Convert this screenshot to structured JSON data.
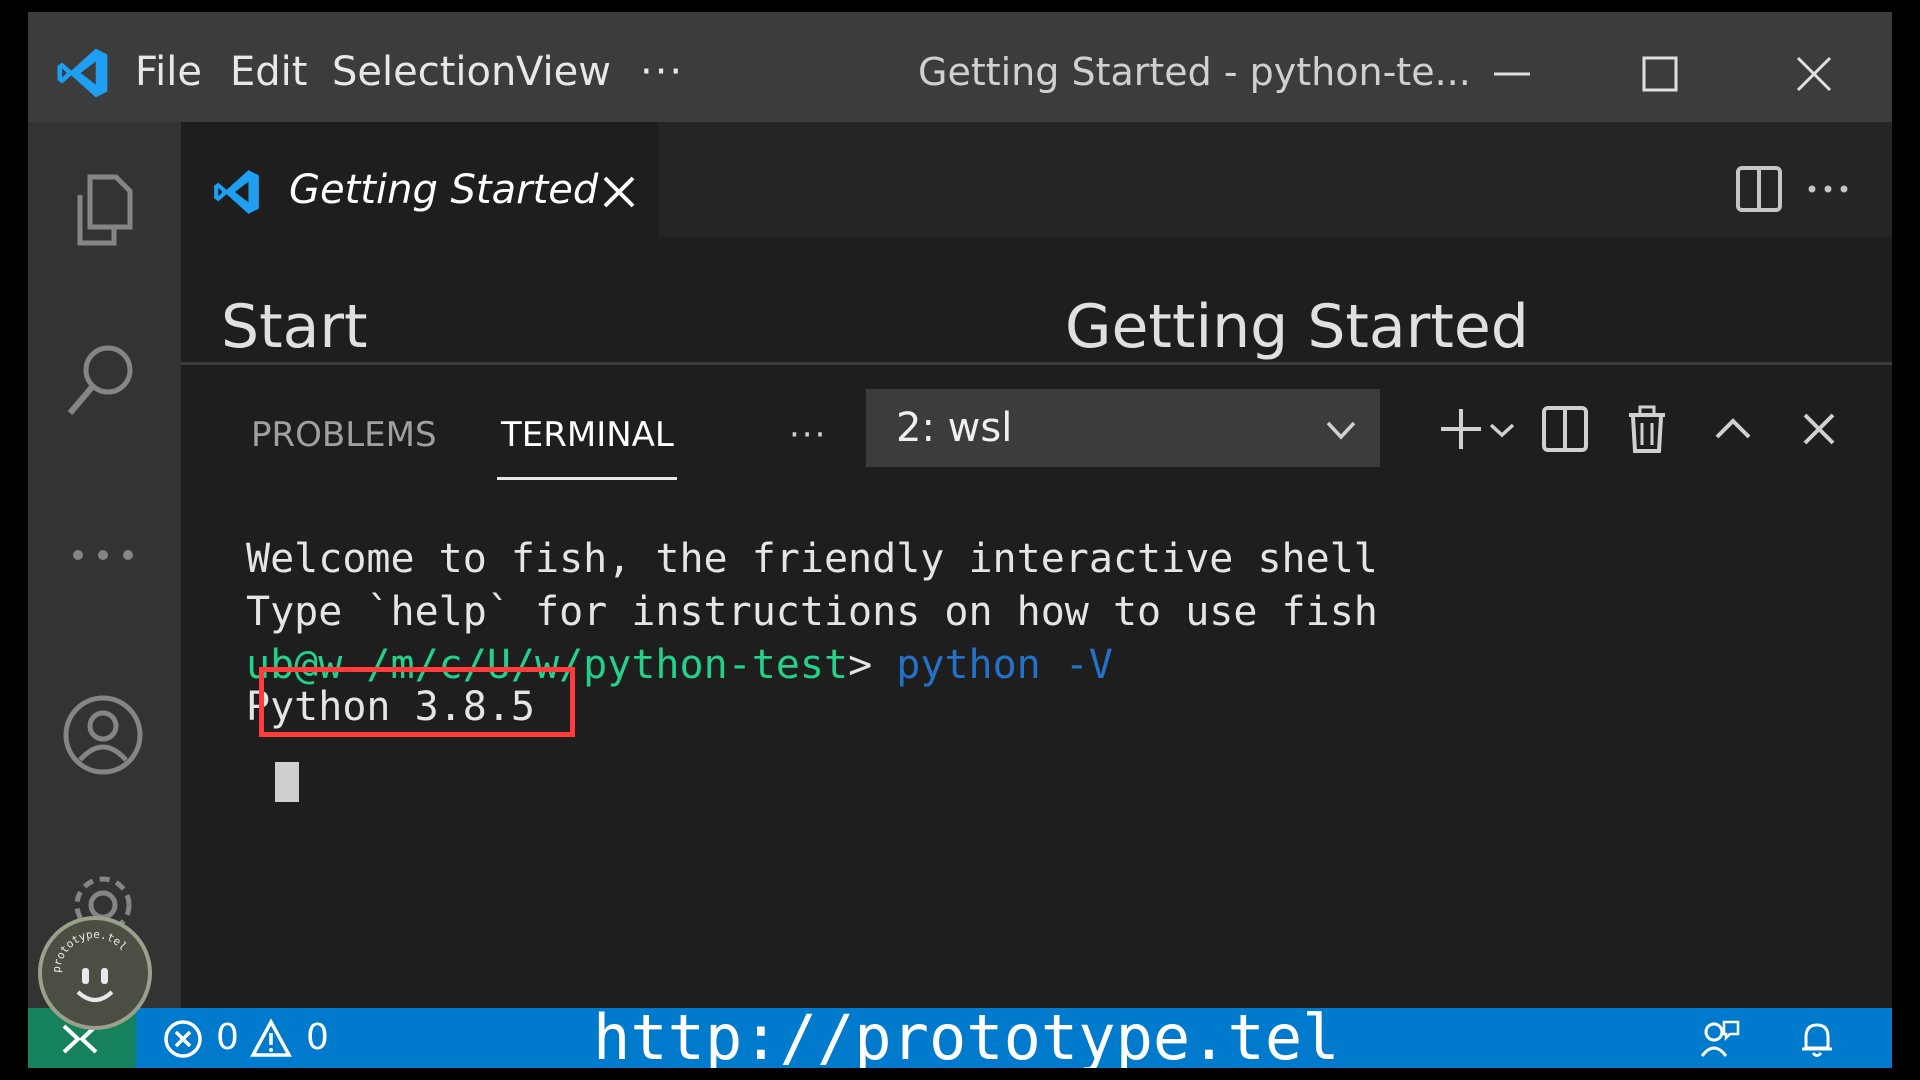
{
  "titlebar": {
    "menu": [
      "File",
      "Edit",
      "Selection",
      "View",
      "···"
    ],
    "title": "Getting Started - python-te...",
    "icons": [
      "vscode-logo",
      "minimize-icon",
      "maximize-icon",
      "close-icon"
    ]
  },
  "activity_bar": {
    "icons": [
      "explorer-icon",
      "search-icon",
      "more-icon",
      "accounts-icon",
      "gear-icon"
    ]
  },
  "editor_tabs": {
    "active_tab": "Getting Started",
    "actions": [
      "split-editor-icon",
      "more-actions-icon"
    ]
  },
  "editor": {
    "left_heading": "Start",
    "right_heading": "Getting Started"
  },
  "panel": {
    "tabs": [
      "PROBLEMS",
      "TERMINAL"
    ],
    "active_tab": "TERMINAL",
    "more": "···",
    "terminal_select": "2: wsl",
    "actions": [
      "plus-icon",
      "chevron-down-icon",
      "split-terminal-icon",
      "trash-icon",
      "chevron-up-icon",
      "close-panel-icon"
    ]
  },
  "terminal": {
    "welcome_line": "Welcome to fish, the friendly interactive shell",
    "help_line": "Type `help` for instructions on how to use fish",
    "prompt_user": "ub@w",
    "prompt_path": "/m/c/U/w/python-test",
    "prompt_symbol": ">",
    "command": "python -V",
    "output": "Python 3.8.5",
    "colors": {
      "user": "#23d18b",
      "path": "#23d18b",
      "command": "#2472c8",
      "highlight": "#ff3b3b"
    }
  },
  "statusbar": {
    "errors": "0",
    "warnings": "0",
    "url": "http://prototype.tel",
    "icons": [
      "remote-icon",
      "error-icon",
      "warning-icon",
      "feedback-icon",
      "bell-icon"
    ],
    "color": "#007acc"
  },
  "watermark": {
    "text": "prototype.tel"
  }
}
